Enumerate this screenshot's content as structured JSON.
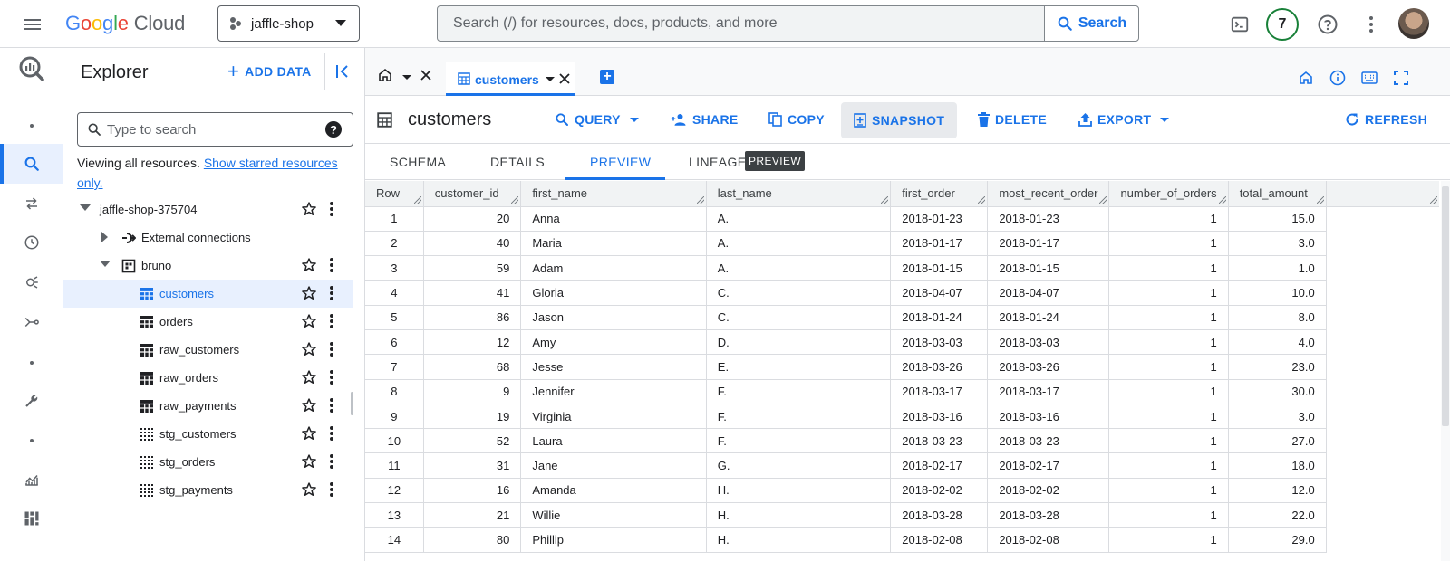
{
  "topbar": {
    "logo_google": "Google",
    "logo_cloud": "Cloud",
    "project": "jaffle-shop",
    "search_placeholder": "Search (/) for resources, docs, products, and more",
    "search_button": "Search",
    "notifications_count": "7"
  },
  "explorer": {
    "title": "Explorer",
    "add_data": "ADD DATA",
    "search_placeholder": "Type to search",
    "viewing_text": "Viewing all resources.",
    "viewing_link": "Show starred resources only.",
    "tree": [
      {
        "label": "jaffle-shop-375704",
        "level": 0,
        "twisty": "down",
        "icon": "none",
        "actions": true
      },
      {
        "label": "External connections",
        "level": 1,
        "twisty": "right",
        "icon": "connection",
        "actions": false
      },
      {
        "label": "bruno",
        "level": 1,
        "twisty": "down",
        "icon": "dataset",
        "actions": true
      },
      {
        "label": "customers",
        "level": 2,
        "twisty": "none",
        "icon": "table",
        "actions": true,
        "selected": true
      },
      {
        "label": "orders",
        "level": 2,
        "twisty": "none",
        "icon": "table",
        "actions": true
      },
      {
        "label": "raw_customers",
        "level": 2,
        "twisty": "none",
        "icon": "table",
        "actions": true
      },
      {
        "label": "raw_orders",
        "level": 2,
        "twisty": "none",
        "icon": "table",
        "actions": true
      },
      {
        "label": "raw_payments",
        "level": 2,
        "twisty": "none",
        "icon": "table",
        "actions": true
      },
      {
        "label": "stg_customers",
        "level": 2,
        "twisty": "none",
        "icon": "view",
        "actions": true
      },
      {
        "label": "stg_orders",
        "level": 2,
        "twisty": "none",
        "icon": "view",
        "actions": true
      },
      {
        "label": "stg_payments",
        "level": 2,
        "twisty": "none",
        "icon": "view",
        "actions": true
      }
    ]
  },
  "tabs": {
    "active_label": "customers"
  },
  "table_header": {
    "title": "customers",
    "actions": {
      "query": "QUERY",
      "share": "SHARE",
      "copy": "COPY",
      "snapshot": "SNAPSHOT",
      "delete": "DELETE",
      "export": "EXPORT",
      "refresh": "REFRESH"
    }
  },
  "subtabs": {
    "schema": "SCHEMA",
    "details": "DETAILS",
    "preview": "PREVIEW",
    "lineage": "LINEAGE",
    "lineage_chip": "PREVIEW"
  },
  "grid": {
    "columns": [
      "Row",
      "customer_id",
      "first_name",
      "last_name",
      "first_order",
      "most_recent_order",
      "number_of_orders",
      "total_amount"
    ],
    "rows": [
      [
        "1",
        "20",
        "Anna",
        "A.",
        "2018-01-23",
        "2018-01-23",
        "1",
        "15.0"
      ],
      [
        "2",
        "40",
        "Maria",
        "A.",
        "2018-01-17",
        "2018-01-17",
        "1",
        "3.0"
      ],
      [
        "3",
        "59",
        "Adam",
        "A.",
        "2018-01-15",
        "2018-01-15",
        "1",
        "1.0"
      ],
      [
        "4",
        "41",
        "Gloria",
        "C.",
        "2018-04-07",
        "2018-04-07",
        "1",
        "10.0"
      ],
      [
        "5",
        "86",
        "Jason",
        "C.",
        "2018-01-24",
        "2018-01-24",
        "1",
        "8.0"
      ],
      [
        "6",
        "12",
        "Amy",
        "D.",
        "2018-03-03",
        "2018-03-03",
        "1",
        "4.0"
      ],
      [
        "7",
        "68",
        "Jesse",
        "E.",
        "2018-03-26",
        "2018-03-26",
        "1",
        "23.0"
      ],
      [
        "8",
        "9",
        "Jennifer",
        "F.",
        "2018-03-17",
        "2018-03-17",
        "1",
        "30.0"
      ],
      [
        "9",
        "19",
        "Virginia",
        "F.",
        "2018-03-16",
        "2018-03-16",
        "1",
        "3.0"
      ],
      [
        "10",
        "52",
        "Laura",
        "F.",
        "2018-03-23",
        "2018-03-23",
        "1",
        "27.0"
      ],
      [
        "11",
        "31",
        "Jane",
        "G.",
        "2018-02-17",
        "2018-02-17",
        "1",
        "18.0"
      ],
      [
        "12",
        "16",
        "Amanda",
        "H.",
        "2018-02-02",
        "2018-02-02",
        "1",
        "12.0"
      ],
      [
        "13",
        "21",
        "Willie",
        "H.",
        "2018-03-28",
        "2018-03-28",
        "1",
        "22.0"
      ],
      [
        "14",
        "80",
        "Phillip",
        "H.",
        "2018-02-08",
        "2018-02-08",
        "1",
        "29.0"
      ]
    ]
  },
  "colors": {
    "accent": "#1a73e8",
    "selected_bg": "#e8f0fe",
    "notification_ring": "#188038"
  }
}
